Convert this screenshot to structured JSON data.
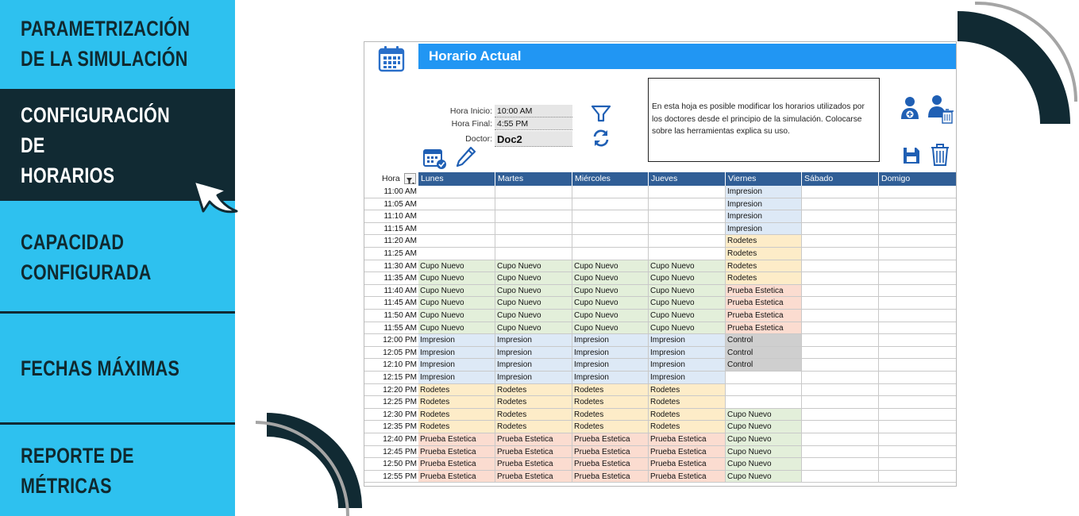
{
  "nav": {
    "items": [
      {
        "label": "PARAMETRIZACIÓN\nDE LA SIMULACIÓN",
        "active": false
      },
      {
        "label": "CONFIGURACIÓN DE\nHORARIOS",
        "active": true
      },
      {
        "label": "CAPACIDAD\nCONFIGURADA",
        "active": false
      },
      {
        "label": "FECHAS MÁXIMAS",
        "active": false
      },
      {
        "label": "REPORTE DE\nMÉTRICAS",
        "active": false
      }
    ]
  },
  "sheet": {
    "title": "Horario Actual",
    "fields": {
      "hora_inicio_label": "Hora Inicio:",
      "hora_inicio_value": "10:00 AM",
      "hora_final_label": "Hora Final:",
      "hora_final_value": "4:55 PM",
      "doctor_label": "Doctor:",
      "doctor_value": "Doc2"
    },
    "info_text": "En esta hoja es posible modificar los horarios utilizados por los doctores desde el principio de la simulación. Colocarse sobre las herramientas explica su uso.",
    "icons": {
      "calendar": "calendar-icon",
      "schedule_check": "calendar-check-icon",
      "edit": "pencil-icon",
      "filter": "funnel-icon",
      "refresh": "refresh-icon",
      "add_doctor": "add-user-icon",
      "delete_doctor": "delete-user-icon",
      "save": "save-icon",
      "trash": "trash-icon"
    },
    "grid": {
      "hora_header": "Hora",
      "days": [
        "Lunes",
        "Martes",
        "Miércoles",
        "Jueves",
        "Viernes",
        "Sábado",
        "Domigo"
      ],
      "rows": [
        {
          "time": "11:00 AM",
          "cells": [
            "",
            "",
            "",
            "",
            "Impresion",
            "",
            ""
          ]
        },
        {
          "time": "11:05 AM",
          "cells": [
            "",
            "",
            "",
            "",
            "Impresion",
            "",
            ""
          ]
        },
        {
          "time": "11:10 AM",
          "cells": [
            "",
            "",
            "",
            "",
            "Impresion",
            "",
            ""
          ]
        },
        {
          "time": "11:15 AM",
          "cells": [
            "",
            "",
            "",
            "",
            "Impresion",
            "",
            ""
          ]
        },
        {
          "time": "11:20 AM",
          "cells": [
            "",
            "",
            "",
            "",
            "Rodetes",
            "",
            ""
          ]
        },
        {
          "time": "11:25 AM",
          "cells": [
            "",
            "",
            "",
            "",
            "Rodetes",
            "",
            ""
          ]
        },
        {
          "time": "11:30 AM",
          "cells": [
            "Cupo Nuevo",
            "Cupo Nuevo",
            "Cupo Nuevo",
            "Cupo Nuevo",
            "Rodetes",
            "",
            ""
          ]
        },
        {
          "time": "11:35 AM",
          "cells": [
            "Cupo Nuevo",
            "Cupo Nuevo",
            "Cupo Nuevo",
            "Cupo Nuevo",
            "Rodetes",
            "",
            ""
          ]
        },
        {
          "time": "11:40 AM",
          "cells": [
            "Cupo Nuevo",
            "Cupo Nuevo",
            "Cupo Nuevo",
            "Cupo Nuevo",
            "Prueba Estetica",
            "",
            ""
          ]
        },
        {
          "time": "11:45 AM",
          "cells": [
            "Cupo Nuevo",
            "Cupo Nuevo",
            "Cupo Nuevo",
            "Cupo Nuevo",
            "Prueba Estetica",
            "",
            ""
          ]
        },
        {
          "time": "11:50 AM",
          "cells": [
            "Cupo Nuevo",
            "Cupo Nuevo",
            "Cupo Nuevo",
            "Cupo Nuevo",
            "Prueba Estetica",
            "",
            ""
          ]
        },
        {
          "time": "11:55 AM",
          "cells": [
            "Cupo Nuevo",
            "Cupo Nuevo",
            "Cupo Nuevo",
            "Cupo Nuevo",
            "Prueba Estetica",
            "",
            ""
          ]
        },
        {
          "time": "12:00 PM",
          "cells": [
            "Impresion",
            "Impresion",
            "Impresion",
            "Impresion",
            "Control",
            "",
            ""
          ]
        },
        {
          "time": "12:05 PM",
          "cells": [
            "Impresion",
            "Impresion",
            "Impresion",
            "Impresion",
            "Control",
            "",
            ""
          ]
        },
        {
          "time": "12:10 PM",
          "cells": [
            "Impresion",
            "Impresion",
            "Impresion",
            "Impresion",
            "Control",
            "",
            ""
          ]
        },
        {
          "time": "12:15 PM",
          "cells": [
            "Impresion",
            "Impresion",
            "Impresion",
            "Impresion",
            "",
            "",
            ""
          ]
        },
        {
          "time": "12:20 PM",
          "cells": [
            "Rodetes",
            "Rodetes",
            "Rodetes",
            "Rodetes",
            "",
            "",
            ""
          ]
        },
        {
          "time": "12:25 PM",
          "cells": [
            "Rodetes",
            "Rodetes",
            "Rodetes",
            "Rodetes",
            "",
            "",
            ""
          ]
        },
        {
          "time": "12:30 PM",
          "cells": [
            "Rodetes",
            "Rodetes",
            "Rodetes",
            "Rodetes",
            "Cupo Nuevo",
            "",
            ""
          ]
        },
        {
          "time": "12:35 PM",
          "cells": [
            "Rodetes",
            "Rodetes",
            "Rodetes",
            "Rodetes",
            "Cupo Nuevo",
            "",
            ""
          ]
        },
        {
          "time": "12:40 PM",
          "cells": [
            "Prueba Estetica",
            "Prueba Estetica",
            "Prueba Estetica",
            "Prueba Estetica",
            "Cupo Nuevo",
            "",
            ""
          ]
        },
        {
          "time": "12:45 PM",
          "cells": [
            "Prueba Estetica",
            "Prueba Estetica",
            "Prueba Estetica",
            "Prueba Estetica",
            "Cupo Nuevo",
            "",
            ""
          ]
        },
        {
          "time": "12:50 PM",
          "cells": [
            "Prueba Estetica",
            "Prueba Estetica",
            "Prueba Estetica",
            "Prueba Estetica",
            "Cupo Nuevo",
            "",
            ""
          ]
        },
        {
          "time": "12:55 PM",
          "cells": [
            "Prueba Estetica",
            "Prueba Estetica",
            "Prueba Estetica",
            "Prueba Estetica",
            "Cupo Nuevo",
            "",
            ""
          ]
        }
      ]
    }
  },
  "colors": {
    "nav_bg": "#2ec1ef",
    "nav_active_bg": "#112a33",
    "title_bar": "#2196f3",
    "day_header": "#305e96",
    "cupo_nuevo": "#e3efda",
    "impresion": "#dde9f6",
    "rodetes": "#fdecc8",
    "prueba_estetica": "#fbdcd0",
    "control": "#cfcfcf"
  }
}
